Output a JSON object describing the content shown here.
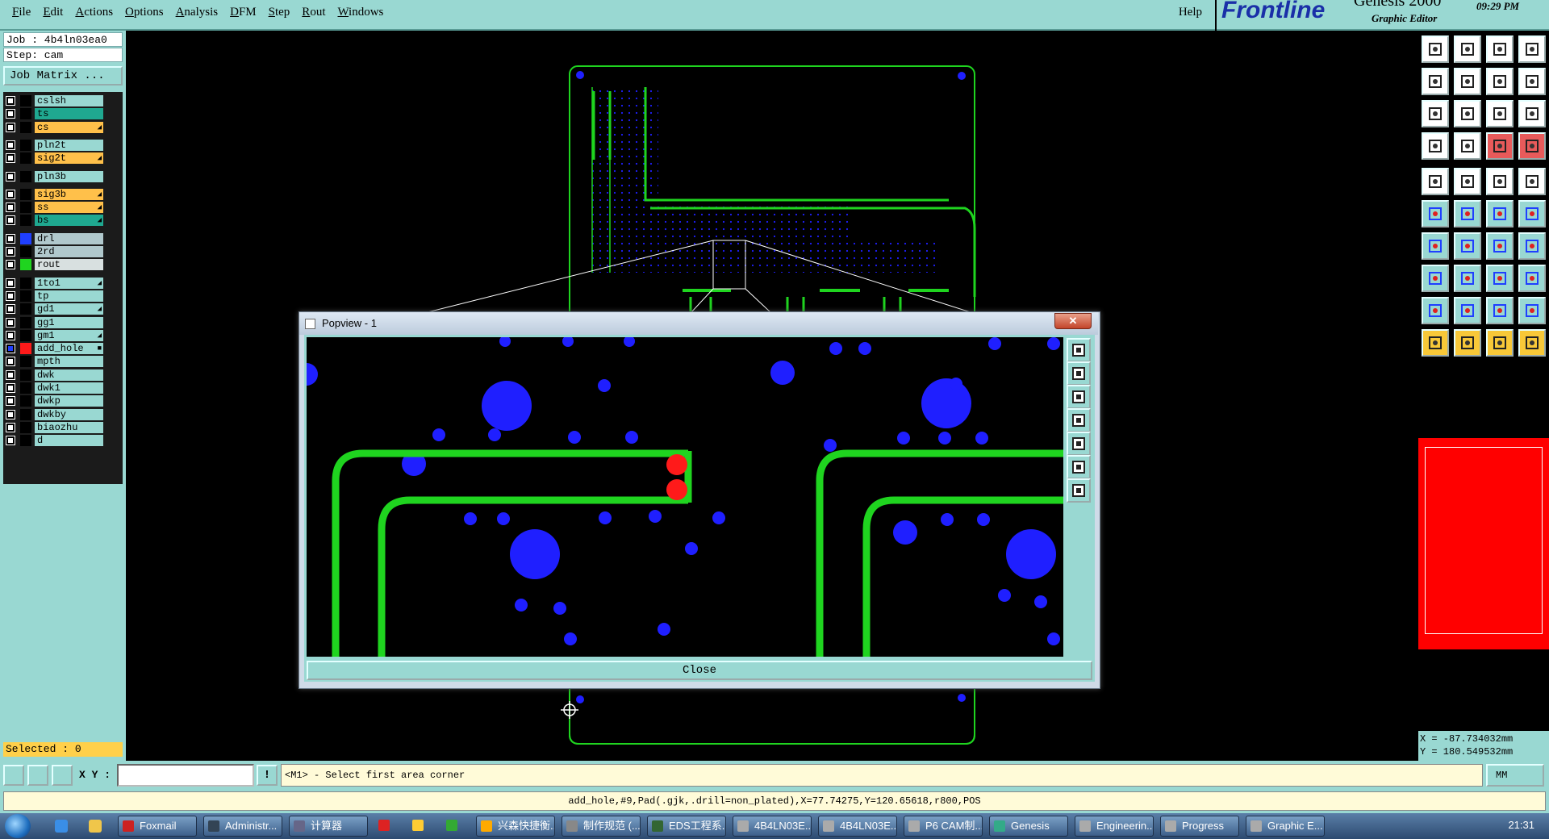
{
  "menu": [
    "File",
    "Edit",
    "Actions",
    "Options",
    "Analysis",
    "DFM",
    "Step",
    "Rout",
    "Windows"
  ],
  "help_label": "Help",
  "brand": {
    "logo": "Frontline",
    "product": "Genesis 2000",
    "subtitle": "Graphic Editor",
    "time": "09:29 PM"
  },
  "job": {
    "job_line": "Job : 4b4ln03ea0",
    "step_line": "Step: cam",
    "matrix_button": "Job Matrix ..."
  },
  "layers": [
    {
      "name": "cslsh",
      "bg": "#99d8d2",
      "sw": "#000",
      "mark": ""
    },
    {
      "name": "ts",
      "bg": "#1fa890",
      "sw": "#000",
      "mark": ""
    },
    {
      "name": "cs",
      "bg": "#ffc04a",
      "sw": "#000",
      "mark": "◢"
    },
    {
      "name": "pln2t",
      "bg": "#99d8d2",
      "sw": "#000",
      "mark": ""
    },
    {
      "name": "sig2t",
      "bg": "#ffc04a",
      "sw": "#000",
      "mark": "◢"
    },
    {
      "name": "pln3b",
      "bg": "#99d8d2",
      "sw": "#000",
      "mark": ""
    },
    {
      "name": "sig3b",
      "bg": "#ffc04a",
      "sw": "#000",
      "mark": "◢"
    },
    {
      "name": "ss",
      "bg": "#ffc04a",
      "sw": "#000",
      "mark": "◢"
    },
    {
      "name": "bs",
      "bg": "#1fa890",
      "sw": "#000",
      "mark": "◢"
    },
    {
      "name": "drl",
      "bg": "#b0c8cc",
      "sw": "#1f3fff",
      "mark": ""
    },
    {
      "name": "2rd",
      "bg": "#b0c8cc",
      "sw": "#000",
      "mark": ""
    },
    {
      "name": "rout",
      "bg": "#d8e0e0",
      "sw": "#1fd41f",
      "mark": ""
    },
    {
      "name": "1to1",
      "bg": "#99d8d2",
      "sw": "#000",
      "mark": "◢"
    },
    {
      "name": "tp",
      "bg": "#99d8d2",
      "sw": "#000",
      "mark": ""
    },
    {
      "name": "gd1",
      "bg": "#99d8d2",
      "sw": "#000",
      "mark": "◢"
    },
    {
      "name": "gg1",
      "bg": "#99d8d2",
      "sw": "#000",
      "mark": ""
    },
    {
      "name": "gm1",
      "bg": "#99d8d2",
      "sw": "#000",
      "mark": "◢"
    },
    {
      "name": "add_hole",
      "bg": "#99d8d2",
      "sw": "#ff1a1a",
      "mark": "■"
    },
    {
      "name": "mpth",
      "bg": "#99d8d2",
      "sw": "#000",
      "mark": ""
    },
    {
      "name": "dwk",
      "bg": "#99d8d2",
      "sw": "#000",
      "mark": ""
    },
    {
      "name": "dwk1",
      "bg": "#99d8d2",
      "sw": "#000",
      "mark": ""
    },
    {
      "name": "dwkp",
      "bg": "#99d8d2",
      "sw": "#000",
      "mark": ""
    },
    {
      "name": "dwkby",
      "bg": "#99d8d2",
      "sw": "#000",
      "mark": ""
    },
    {
      "name": "biaozhu",
      "bg": "#99d8d2",
      "sw": "#000",
      "mark": ""
    },
    {
      "name": "d",
      "bg": "#99d8d2",
      "sw": "#000",
      "mark": ""
    }
  ],
  "selected_text": "Selected : 0",
  "coords": {
    "x": "X = -87.734032mm",
    "y": "Y = 180.549532mm"
  },
  "cmd": {
    "xy_label": "X Y :",
    "input_value": "",
    "alert": "!",
    "prompt": "<M1> - Select first area corner",
    "units": "MM"
  },
  "status_line": "add_hole,#9,Pad(.gjk,.drill=non_plated),X=77.74275,Y=120.65618,r800,POS",
  "popview": {
    "title": "Popview - 1",
    "close_x": "✕",
    "close_button": "Close"
  },
  "colors": {
    "panel": "#99d8d2",
    "trace": "#1fd41f",
    "drill": "#1f1fff",
    "hole": "#ff1a1a"
  },
  "taskbar": {
    "tasks": [
      "Foxmail",
      "Administr...",
      "计算器",
      "",
      "",
      "",
      "兴森快捷衡...",
      "制作规范 (...",
      "EDS工程系...",
      "4B4LN03E...",
      "4B4LN03E...",
      "P6 CAM制...",
      "Genesis",
      "Engineerin...",
      "Progress",
      "Graphic E..."
    ],
    "clock": "21:31"
  }
}
